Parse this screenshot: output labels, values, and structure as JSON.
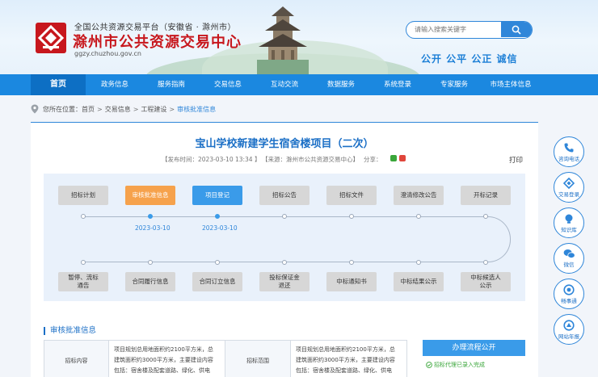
{
  "header": {
    "subtitle": "全国公共资源交易平台（安徽省 · 滁州市）",
    "site_name": "滁州市公共资源交易中心",
    "url": "ggzy.chuzhou.gov.cn",
    "search_placeholder": "请输入搜索关键字",
    "slogan": "公开 公平 公正 诚信"
  },
  "nav": {
    "items": [
      {
        "label": "首页",
        "active": true
      },
      {
        "label": "政务信息"
      },
      {
        "label": "服务指南"
      },
      {
        "label": "交易信息"
      },
      {
        "label": "互动交流"
      },
      {
        "label": "数据服务"
      },
      {
        "label": "系统登录"
      },
      {
        "label": "专家服务"
      },
      {
        "label": "市场主体信息"
      }
    ]
  },
  "breadcrumb": {
    "prefix": "您所在位置：",
    "items": [
      "首页",
      "交易信息",
      "工程建设",
      "审核批准信息"
    ]
  },
  "article": {
    "title": "宝山学校新建学生宿舍楼项目（二次）",
    "publish_time": "【发布时间：2023-03-10 13:34 】",
    "source": "【来源：滁州市公共资源交易中心】",
    "share_label": "分享：",
    "print_label": "打印"
  },
  "flow": {
    "top_steps": [
      {
        "label": "招标计划",
        "state": "none"
      },
      {
        "label": "审核批准信息",
        "state": "current"
      },
      {
        "label": "项目登记",
        "state": "done"
      },
      {
        "label": "招标公告",
        "state": "none"
      },
      {
        "label": "招标文件",
        "state": "none"
      },
      {
        "label": "澄清修改公告",
        "state": "none"
      },
      {
        "label": "开标记录",
        "state": "none"
      }
    ],
    "dates": [
      "",
      "2023-03-10",
      "2023-03-10",
      "",
      "",
      "",
      ""
    ],
    "bottom_steps": [
      [
        "暂停、流标",
        "通告"
      ],
      [
        "合同履行信息"
      ],
      [
        "合同订立信息"
      ],
      [
        "投标保证金",
        "退还"
      ],
      [
        "中标通知书"
      ],
      [
        "中标结果公示"
      ],
      [
        "中标候选人",
        "公示"
      ]
    ]
  },
  "section": {
    "title": "审核批准信息",
    "row_label_1": "招标内容",
    "row_text_1": [
      "项目规划总用地面积约2100平方米，总",
      "建筑面积约3000平方米，主要建设内容",
      "包括：宿舍楼及配套道路、绿化、供电"
    ],
    "row_label_2": "招标范围",
    "row_text_2": [
      "项目规划总用地面积约2100平方米，总",
      "建筑面积约3000平方米，主要建设内容",
      "包括：宿舍楼及配套道路、绿化、供电"
    ]
  },
  "process": {
    "title": "办理流程公开",
    "item": "招标代理已录入完成"
  },
  "rail": [
    {
      "label": "咨询电话",
      "icon": "phone-icon"
    },
    {
      "label": "交易登录",
      "icon": "login-icon"
    },
    {
      "label": "知识库",
      "icon": "knowledge-icon"
    },
    {
      "label": "微信",
      "icon": "wechat-icon"
    },
    {
      "label": "畅事通",
      "icon": "chat-icon"
    },
    {
      "label": "网站年报",
      "icon": "report-icon"
    }
  ],
  "colors": {
    "brand_blue": "#1b88e0",
    "title_blue": "#1b6fc6",
    "brand_red": "#c7171d",
    "step_current": "#f6a24c",
    "step_done": "#3a9be9",
    "step_none": "#d7d7d7"
  }
}
